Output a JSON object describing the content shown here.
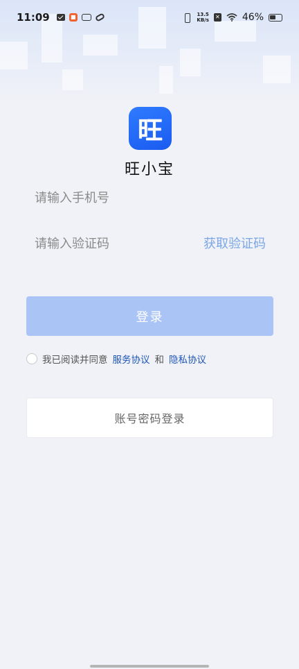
{
  "status_bar": {
    "time": "11:09",
    "net_speed_value": "13.5",
    "net_speed_unit": "KB/s",
    "battery_percent": "46%",
    "icons": [
      "mail-icon",
      "app-notification-icon",
      "vivo-icon",
      "link-icon",
      "vibrate-icon",
      "sim-icon",
      "wifi-icon",
      "battery-icon"
    ]
  },
  "app": {
    "logo_char": "旺",
    "name": "旺小宝",
    "brand_color": "#1a5bf0"
  },
  "form": {
    "phone_placeholder": "请输入手机号",
    "code_placeholder": "请输入验证码",
    "get_code_label": "获取验证码",
    "login_label": "登录",
    "login_button_color": "#aac4f6"
  },
  "agreement": {
    "prefix": "我已阅读并同意",
    "service_link": "服务协议",
    "and": "和",
    "privacy_link": "隐私协议",
    "link_color": "#1e56b8"
  },
  "alt_login": {
    "password_login_label": "账号密码登录"
  }
}
